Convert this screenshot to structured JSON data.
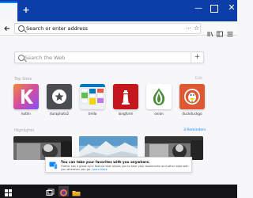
{
  "browser": {
    "newtab_symbol": "+",
    "window_controls": {
      "minimize": "—",
      "close": "✕"
    }
  },
  "navbar": {
    "url_placeholder": "Search or enter address",
    "page_actions_symbol": "···",
    "bookmark_symbol": "☆",
    "icons": [
      "library-icon",
      "sidebar-icon",
      "menu-icon"
    ]
  },
  "search": {
    "placeholder": "Search the Web",
    "go_symbol": "+"
  },
  "top_sites": {
    "title": "Top Sites",
    "edit_label": "Edit",
    "tiles": [
      {
        "label": "kotlin",
        "color": "#d94a93"
      },
      {
        "label": "duraphoto2",
        "color": "#4a4d52"
      },
      {
        "label": "trello",
        "color": "#ffffff"
      },
      {
        "label": "longform",
        "color": "#c4161c"
      },
      {
        "label": "onion",
        "color": "#ffffff"
      },
      {
        "label": "duckduckgo",
        "color": "#de5833"
      }
    ]
  },
  "highlights": {
    "title": "Highlights",
    "reminders_label": "3 Reminders"
  },
  "notice": {
    "title": "You can take your favorites with you anywhere.",
    "body": "Firefox has a great sync feature that allows you to take your bookmarks and other data with you wherever you go.",
    "link": "Learn More"
  },
  "colors": {
    "tab_strip": "#0b3ea8",
    "accent": "#0a84ff",
    "page_background": "#f7f7fa",
    "taskbar": "#131318"
  }
}
